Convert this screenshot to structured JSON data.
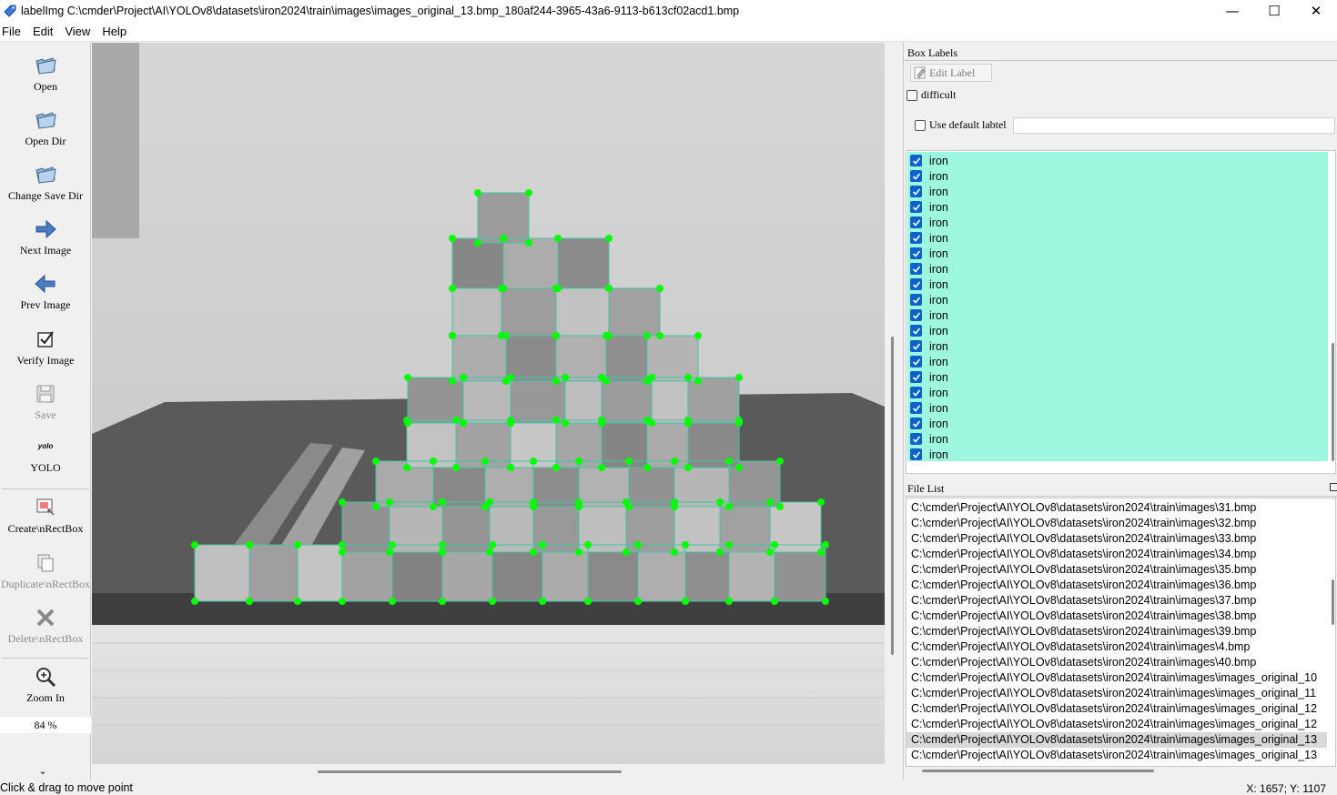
{
  "window": {
    "title": "labelImg C:\\cmder\\Project\\AI\\YOLOv8\\datasets\\iron2024\\train\\images\\images_original_13.bmp_180af244-3965-43a6-9113-b613cf02acd1.bmp",
    "minimize": "—",
    "maximize": "☐",
    "close": "✕"
  },
  "menu": [
    "File",
    "Edit",
    "View",
    "Help"
  ],
  "toolbar": {
    "open": "Open",
    "open_dir": "Open Dir",
    "change_save_dir": "Change Save Dir",
    "next_image": "Next Image",
    "prev_image": "Prev Image",
    "verify_image": "Verify Image",
    "save": "Save",
    "yolo_icon_text": "yolo",
    "yolo": "YOLO",
    "create_rectbox": "Create\\nRectBox",
    "duplicate_rectbox": "Duplicate\\nRectBox",
    "delete_rectbox": "Delete\\nRectBox",
    "zoom_in": "Zoom In",
    "zoom_value": "84 %",
    "more": "⌄"
  },
  "box_labels": {
    "header": "Box Labels",
    "edit_label": "Edit Label",
    "difficult": "difficult",
    "use_default_label": "Use default labtel",
    "default_label_value": "",
    "labels": [
      "iron",
      "iron",
      "iron",
      "iron",
      "iron",
      "iron",
      "iron",
      "iron",
      "iron",
      "iron",
      "iron",
      "iron",
      "iron",
      "iron",
      "iron",
      "iron",
      "iron",
      "iron",
      "iron",
      "iron"
    ]
  },
  "file_list": {
    "header": "File List",
    "files": [
      "C:\\cmder\\Project\\AI\\YOLOv8\\datasets\\iron2024\\train\\images\\31.bmp",
      "C:\\cmder\\Project\\AI\\YOLOv8\\datasets\\iron2024\\train\\images\\32.bmp",
      "C:\\cmder\\Project\\AI\\YOLOv8\\datasets\\iron2024\\train\\images\\33.bmp",
      "C:\\cmder\\Project\\AI\\YOLOv8\\datasets\\iron2024\\train\\images\\34.bmp",
      "C:\\cmder\\Project\\AI\\YOLOv8\\datasets\\iron2024\\train\\images\\35.bmp",
      "C:\\cmder\\Project\\AI\\YOLOv8\\datasets\\iron2024\\train\\images\\36.bmp",
      "C:\\cmder\\Project\\AI\\YOLOv8\\datasets\\iron2024\\train\\images\\37.bmp",
      "C:\\cmder\\Project\\AI\\YOLOv8\\datasets\\iron2024\\train\\images\\38.bmp",
      "C:\\cmder\\Project\\AI\\YOLOv8\\datasets\\iron2024\\train\\images\\39.bmp",
      "C:\\cmder\\Project\\AI\\YOLOv8\\datasets\\iron2024\\train\\images\\4.bmp",
      "C:\\cmder\\Project\\AI\\YOLOv8\\datasets\\iron2024\\train\\images\\40.bmp",
      "C:\\cmder\\Project\\AI\\YOLOv8\\datasets\\iron2024\\train\\images\\images_original_10",
      "C:\\cmder\\Project\\AI\\YOLOv8\\datasets\\iron2024\\train\\images\\images_original_11",
      "C:\\cmder\\Project\\AI\\YOLOv8\\datasets\\iron2024\\train\\images\\images_original_12",
      "C:\\cmder\\Project\\AI\\YOLOv8\\datasets\\iron2024\\train\\images\\images_original_12",
      "C:\\cmder\\Project\\AI\\YOLOv8\\datasets\\iron2024\\train\\images\\images_original_13",
      "C:\\cmder\\Project\\AI\\YOLOv8\\datasets\\iron2024\\train\\images\\images_original_13"
    ],
    "selected_index": 15
  },
  "status": {
    "message": "Click & drag to move point",
    "coords": "X: 1657; Y: 1107"
  },
  "colors": {
    "label_selection": "#9ef8e0",
    "box_vertex": "#00ff00",
    "box_edge": "#3cc8a0",
    "checkbox_checked": "#0b63c8"
  }
}
